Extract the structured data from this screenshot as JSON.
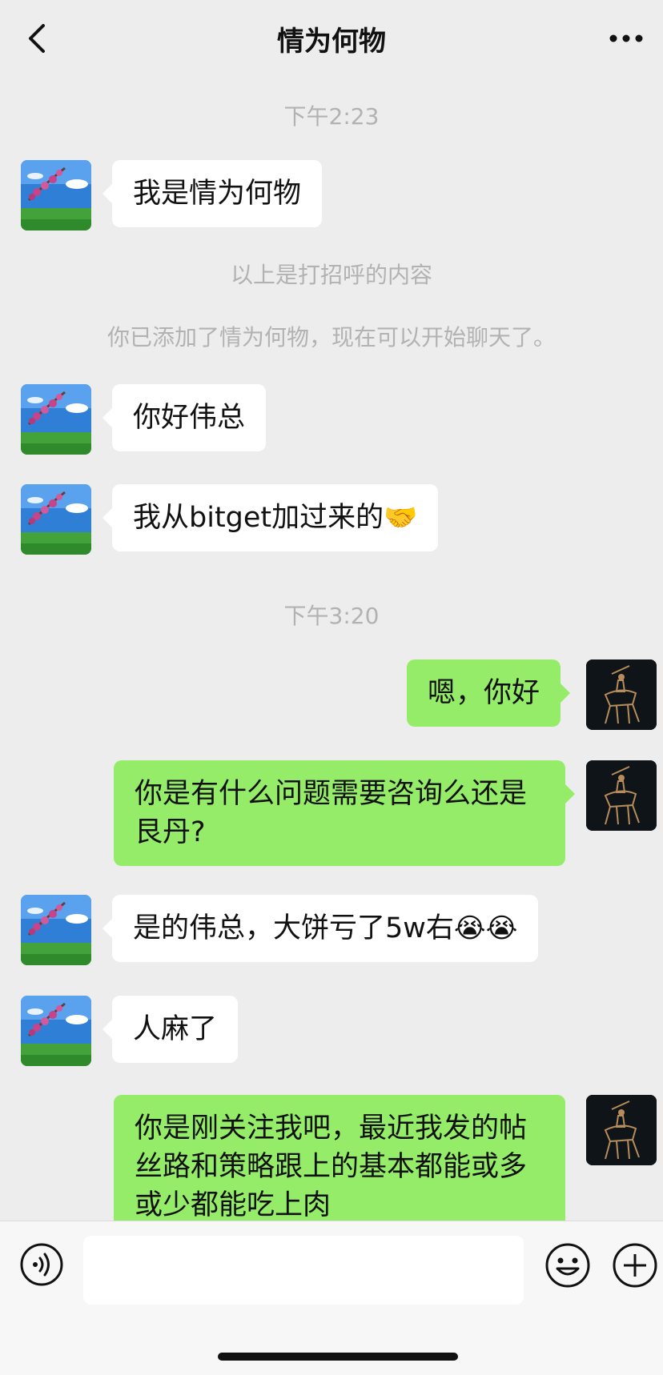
{
  "header": {
    "title": "情为何物"
  },
  "timestamps": [
    "下午2:23",
    "下午3:20"
  ],
  "system": {
    "greeting_note": "以上是打招呼的内容",
    "added_note": "你已添加了情为何物，现在可以开始聊天了。"
  },
  "messages": [
    {
      "side": "left",
      "lines": [
        "我是情为何物"
      ]
    },
    {
      "side": "left",
      "lines": [
        "你好伟总"
      ]
    },
    {
      "side": "left",
      "lines": [
        "我从bitget加过来的"
      ],
      "emoji": "🤝"
    },
    {
      "side": "right",
      "lines": [
        "嗯，你好"
      ]
    },
    {
      "side": "right",
      "lines": [
        "你是有什么问题需要咨询么还是",
        "艮丹?"
      ]
    },
    {
      "side": "left",
      "lines": [
        "是的伟总，大饼亏了5w右"
      ],
      "emoji": "😭😭"
    },
    {
      "side": "left",
      "lines": [
        "人麻了"
      ]
    },
    {
      "side": "right",
      "lines": [
        "你是刚关注我吧，最近我发的帖",
        "丝路和策略跟上的基本都能或多",
        "或少都能吃上肉"
      ]
    }
  ],
  "icons": {
    "back": "chevron-left-icon",
    "more": "more-dots-icon",
    "voice": "voice-icon",
    "emoji": "smile-icon",
    "add": "plus-icon"
  },
  "colors": {
    "background": "#ededed",
    "bubble_left": "#ffffff",
    "bubble_right": "#95ec69",
    "meta_text": "#b2b2b2"
  }
}
